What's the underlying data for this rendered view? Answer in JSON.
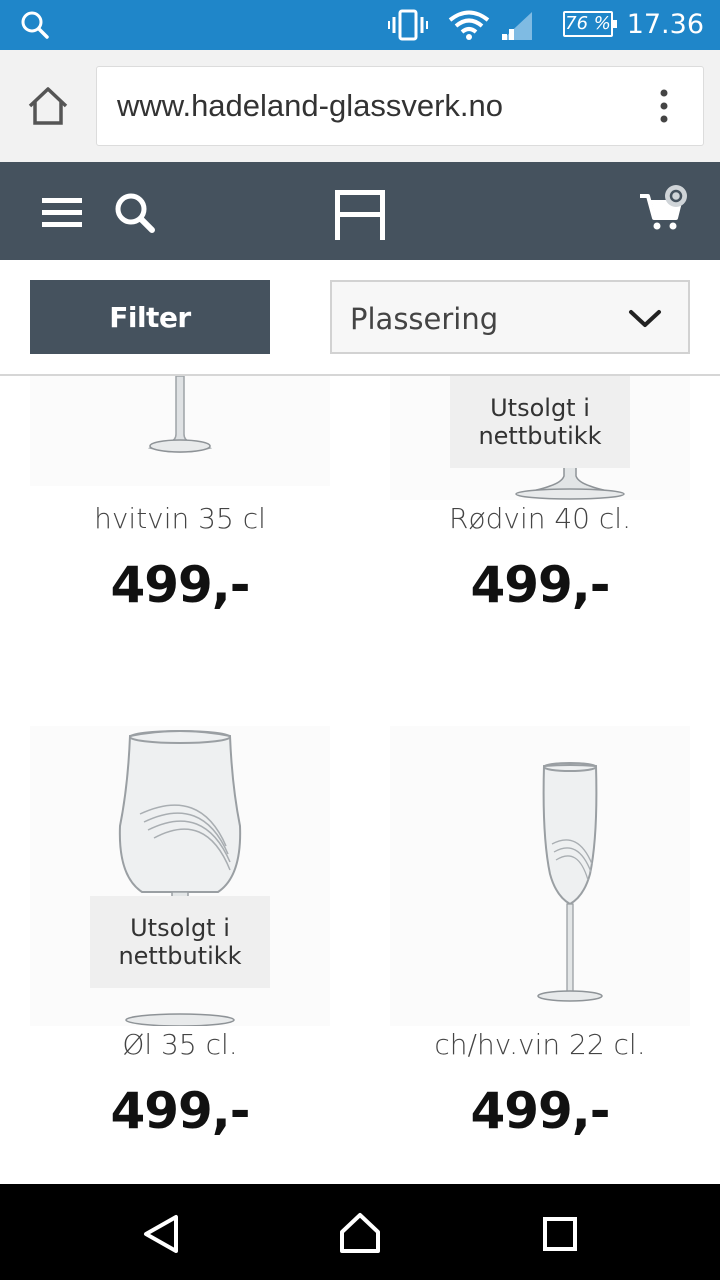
{
  "status_bar": {
    "battery": "76 %",
    "time": "17.36"
  },
  "browser": {
    "url": "www.hadeland-glassverk.no"
  },
  "site_header": {
    "cart_count": "0"
  },
  "toolbar": {
    "filter_label": "Filter",
    "sort_selected": "Plassering"
  },
  "products": [
    {
      "name": "hvitvin 35 cl",
      "price": "499,-",
      "badge": ""
    },
    {
      "name": "Rødvin 40 cl.",
      "price": "499,-",
      "badge_line1": "Utsolgt i",
      "badge_line2": "nettbutikk"
    },
    {
      "name": "Øl 35 cl.",
      "price": "499,-",
      "badge_line1": "Utsolgt i",
      "badge_line2": "nettbutikk"
    },
    {
      "name": "ch/hv.vin 22 cl.",
      "price": "499,-",
      "badge": ""
    }
  ],
  "colors": {
    "status_bar": "#1f86c9",
    "header": "#45525e",
    "nav_bar": "#000000"
  }
}
